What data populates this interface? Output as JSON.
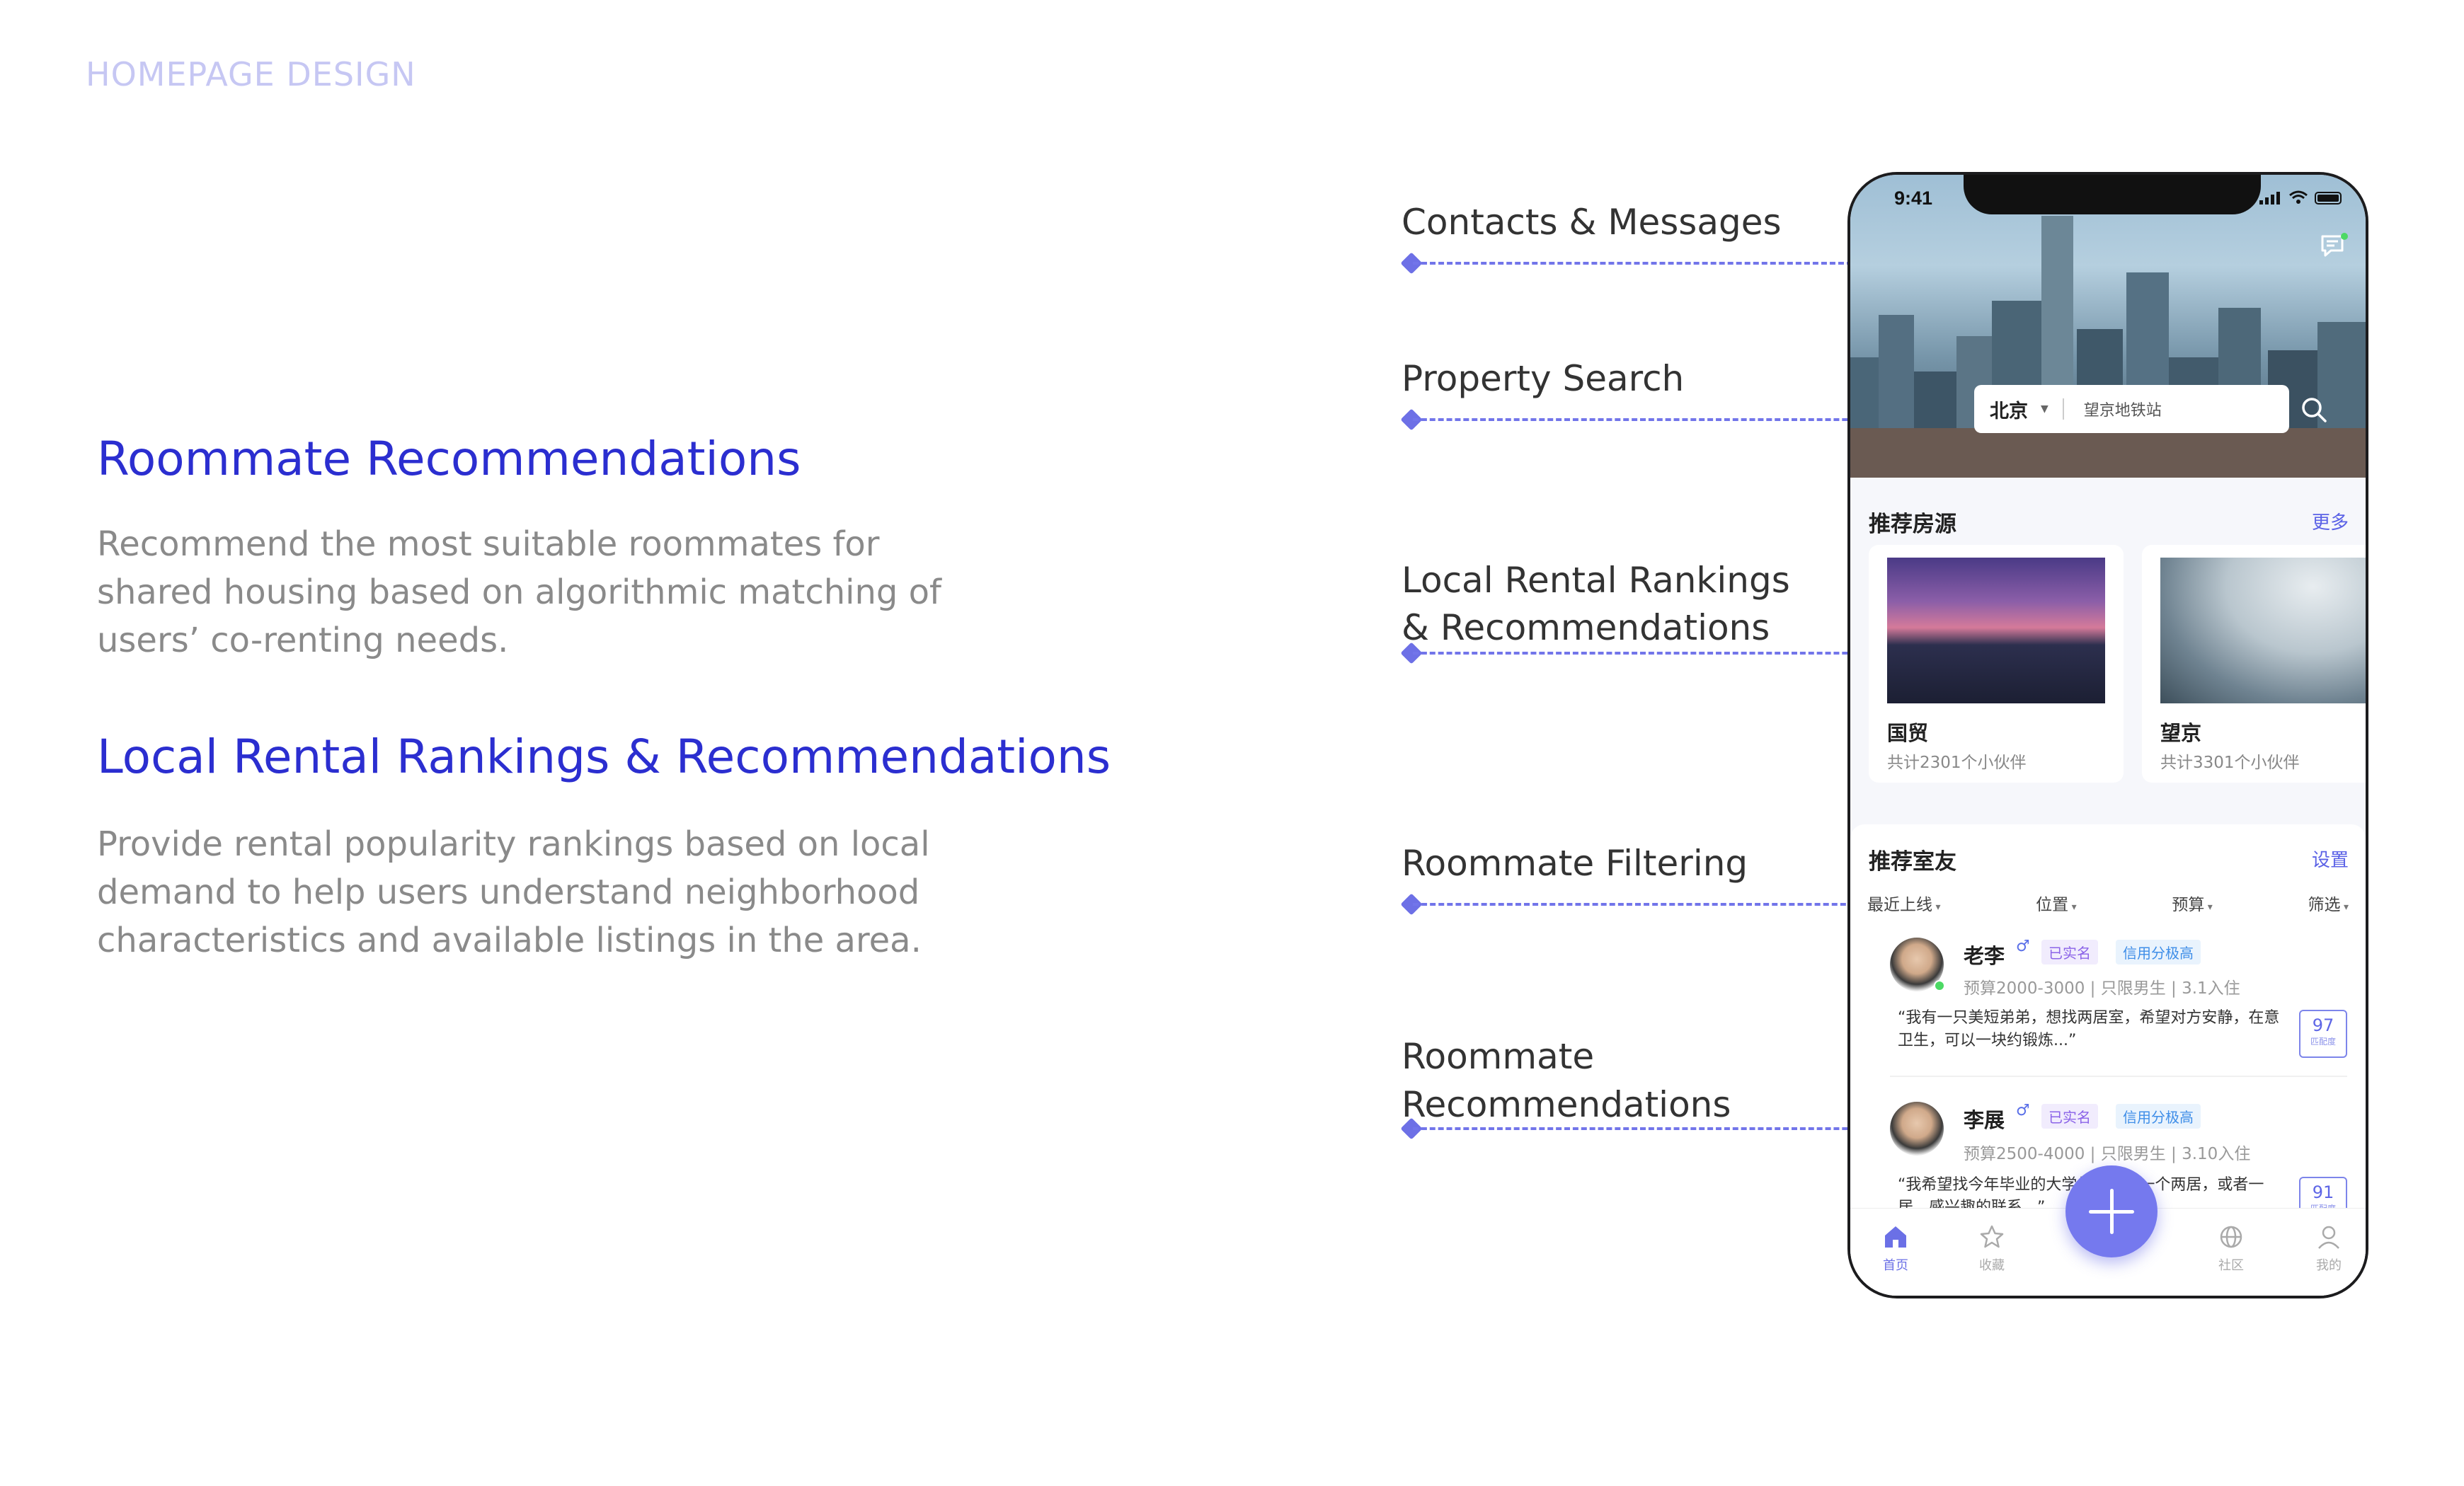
{
  "page_label": "HOMEPAGE DESIGN",
  "features": [
    {
      "title": "Roommate Recommendations",
      "description": "Recommend the most suitable roommates for shared housing based on algorithmic matching of users’ co-renting needs."
    },
    {
      "title": "Local Rental Rankings & Recommendations",
      "description": "Provide rental popularity rankings based on local demand to help users understand neighborhood characteristics and available listings in the area."
    }
  ],
  "callouts": [
    "Contacts & Messages",
    "Property Search",
    "Local Rental Rankings",
    "& Recommendations",
    "Roommate Filtering",
    "Roommate",
    "Recommendations"
  ],
  "phone": {
    "time": "9:41",
    "search": {
      "city": "北京",
      "placeholder": "望京地铁站"
    },
    "listings": {
      "title": "推荐房源",
      "more": "更多",
      "items": [
        {
          "name": "国贸",
          "count": "共计2301个小伙伴"
        },
        {
          "name": "望京",
          "count": "共计3301个小伙伴"
        }
      ]
    },
    "roommates": {
      "title": "推荐室友",
      "settings": "设置",
      "filters": [
        "最近上线",
        "位置",
        "预算",
        "筛选"
      ],
      "items": [
        {
          "name": "老李",
          "gender": "♂",
          "tag_verified": "已实名",
          "tag_credit": "信用分极高",
          "meta": "预算2000-3000 | 只限男生 | 3.1入住",
          "quote": "“我有一只美短弟弟，想找两居室，希望对方安静，在意卫生，可以一块约锻炼...”",
          "score": "97",
          "score_label": "匹配度"
        },
        {
          "name": "李展",
          "gender": "♂",
          "tag_verified": "已实名",
          "tag_credit": "信用分极高",
          "meta": "预算2500-4000 | 只限男生 | 3.10入住",
          "quote": "“我希望找今年毕业的大学生配合租一个两居，或者一居，感兴趣的联系...”",
          "score": "91",
          "score_label": "匹配度"
        }
      ]
    },
    "tabs": [
      "首页",
      "收藏",
      "社区",
      "我的"
    ]
  },
  "colors": {
    "accent": "#2b2ed0",
    "purple": "#7579ee"
  }
}
